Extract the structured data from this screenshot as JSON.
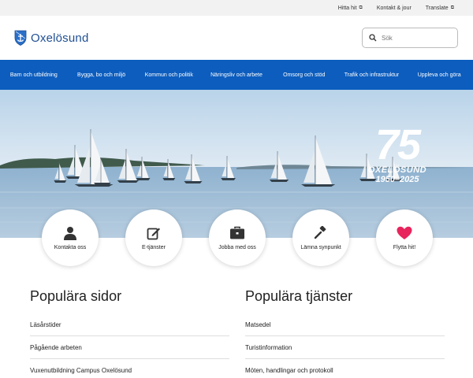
{
  "utility": {
    "items": [
      {
        "label": "Hitta hit"
      },
      {
        "label": "Kontakt & jour"
      },
      {
        "label": "Translate"
      }
    ]
  },
  "header": {
    "logo_text": "Oxelösund",
    "search_placeholder": "Sök"
  },
  "nav": {
    "items": [
      {
        "label": "Barn och utbildning"
      },
      {
        "label": "Bygga, bo och miljö"
      },
      {
        "label": "Kommun och politik"
      },
      {
        "label": "Näringsliv och arbete"
      },
      {
        "label": "Omsorg och stöd"
      },
      {
        "label": "Trafik och infrastruktur"
      },
      {
        "label": "Uppleva och göra"
      }
    ]
  },
  "hero": {
    "number": "75",
    "name": "OXELÖSUND",
    "years": "1950–2025"
  },
  "quick_links": [
    {
      "label": "Kontakta oss",
      "icon": "person-icon"
    },
    {
      "label": "E-tjänster",
      "icon": "edit-icon"
    },
    {
      "label": "Jobba med oss",
      "icon": "briefcase-icon"
    },
    {
      "label": "Lämna synpunkt",
      "icon": "gavel-icon"
    },
    {
      "label": "Flytta hit!",
      "icon": "heart-icon"
    }
  ],
  "popular_pages": {
    "title": "Populära sidor",
    "items": [
      "Läsårstider",
      "Pågående arbeten",
      "Vuxenutbildning Campus Oxelösund"
    ]
  },
  "popular_services": {
    "title": "Populära tjänster",
    "items": [
      "Matsedel",
      "Turistinformation",
      "Möten, handlingar och protokoll"
    ]
  },
  "colors": {
    "nav_background": "#0c5dbe",
    "logo_text": "#1f4f93",
    "heart": "#e8245c",
    "icon": "#333333"
  }
}
